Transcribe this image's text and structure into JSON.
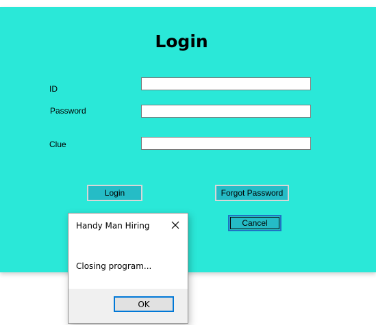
{
  "form": {
    "title": "Login",
    "fields": {
      "id_label": "ID",
      "id_value": "",
      "password_label": "Password",
      "password_value": "",
      "clue_label": "Clue",
      "clue_value": ""
    },
    "buttons": {
      "login": "Login",
      "forgot_password": "Forgot Password",
      "cancel": "Cancel"
    },
    "background_color": "#2ae8d8",
    "button_color": "#25bcc6"
  },
  "dialog": {
    "title": "Handy Man Hiring",
    "close_icon": "close-icon",
    "message": "Closing program...",
    "ok_label": "OK"
  }
}
